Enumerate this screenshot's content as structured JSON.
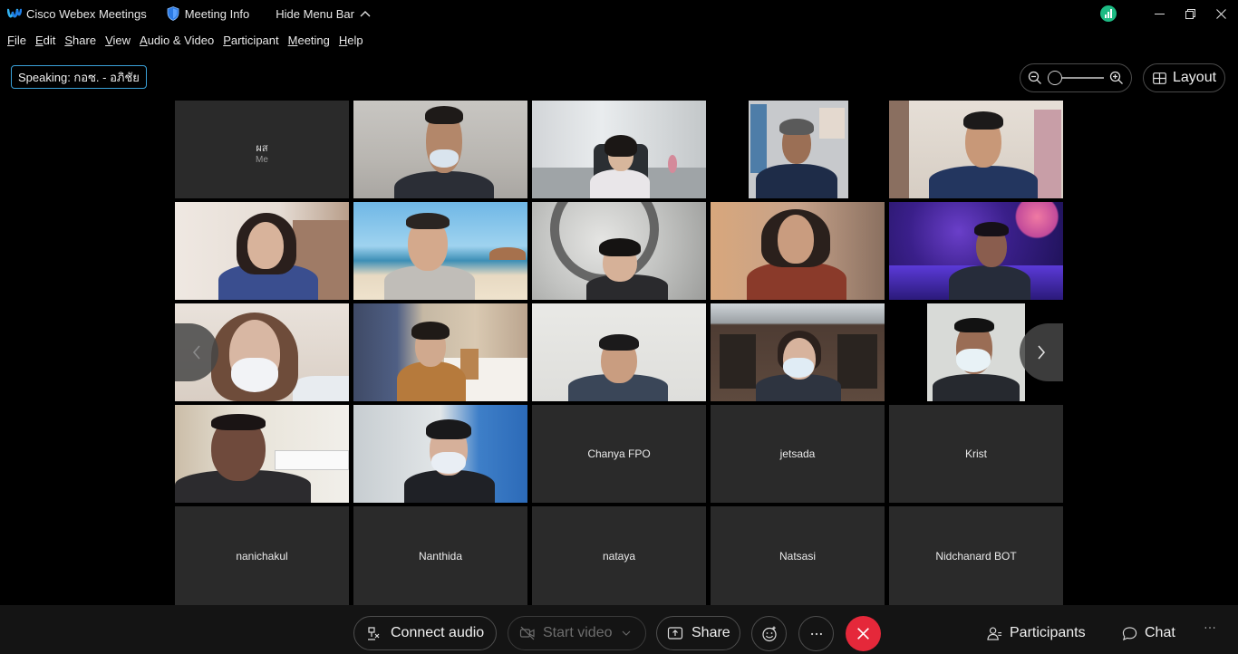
{
  "titlebar": {
    "app_name": "Cisco Webex Meetings",
    "meeting_info": "Meeting Info",
    "hide_menu_bar": "Hide Menu Bar"
  },
  "menu": [
    "File",
    "Edit",
    "Share",
    "View",
    "Audio & Video",
    "Participant",
    "Meeting",
    "Help"
  ],
  "speaking": "Speaking: กอซ. - อภิชัย",
  "layout_button": "Layout",
  "self_tile": {
    "name": "ผส",
    "label": "Me"
  },
  "name_tiles": [
    "Chanya FPO",
    "jetsada",
    "Krist",
    "nanichakul",
    "Nanthida",
    "nataya",
    "Natsasi",
    "Nidchanard BOT"
  ],
  "toolbar": {
    "connect_audio": "Connect audio",
    "start_video": "Start video",
    "share": "Share",
    "participants": "Participants",
    "chat": "Chat"
  },
  "colors": {
    "speaking_border": "#3aa1d9",
    "end_call": "#e5283a",
    "signal": "#1dbb84"
  }
}
